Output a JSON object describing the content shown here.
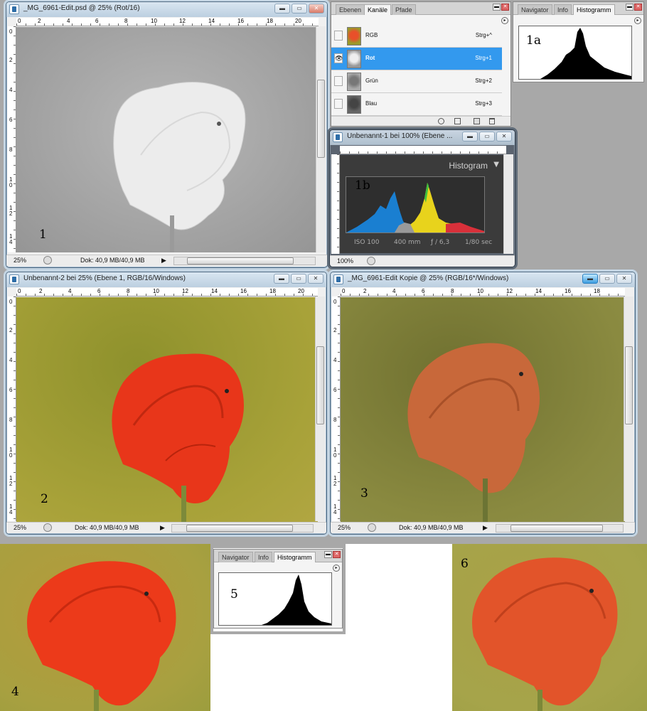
{
  "windows": {
    "w1": {
      "title": "_MG_6961-Edit.psd @ 25% (Rot/16)",
      "zoom": "25%",
      "doc": "Dok: 40,9 MB/40,9 MB",
      "label": "1"
    },
    "w2": {
      "title": "Unbenannt-2 bei 25% (Ebene 1, RGB/16/Windows)",
      "zoom": "25%",
      "doc": "Dok: 40,9 MB/40,9 MB",
      "label": "2"
    },
    "w3": {
      "title": "_MG_6961-Edit Kopie @ 25% (RGB/16*/Windows)",
      "zoom": "25%",
      "doc": "Dok: 40,9 MB/40,9 MB",
      "label": "3"
    },
    "wb": {
      "title": "Unbenannt-1 bei 100% (Ebene ...",
      "zoom": "100%",
      "label": "1b",
      "hist_title": "Histogram",
      "iso": "ISO 100",
      "focal": "400 mm",
      "aperture": "ƒ / 6,3",
      "shutter": "1/80 sec"
    }
  },
  "ruler_h_numbers": [
    "0",
    "2",
    "4",
    "6",
    "8",
    "10",
    "12",
    "14",
    "16",
    "18",
    "20"
  ],
  "ruler_v_numbers": [
    "0",
    "2",
    "4",
    "6",
    "8",
    "1\n0",
    "1\n2",
    "1\n4"
  ],
  "ruler_v_short": [
    "0",
    "2",
    "4",
    "6",
    "8",
    "1\n0",
    "1\n2",
    "1\n4"
  ],
  "channels_panel": {
    "tabs": [
      "Ebenen",
      "Kanäle",
      "Pfade"
    ],
    "rows": [
      {
        "name": "RGB",
        "key": "Strg+^"
      },
      {
        "name": "Rot",
        "key": "Strg+1"
      },
      {
        "name": "Grün",
        "key": "Strg+2"
      },
      {
        "name": "Blau",
        "key": "Strg+3"
      }
    ]
  },
  "histogram_panel_1a": {
    "tabs": [
      "Navigator",
      "Info",
      "Histogramm"
    ],
    "label": "1a"
  },
  "histogram_panel_5": {
    "tabs": [
      "Navigator",
      "Info",
      "Histogramm"
    ],
    "label": "5"
  },
  "standalone_labels": {
    "p4": "4",
    "p6": "6"
  },
  "icons": {
    "min": "minimize-icon",
    "max": "maximize-icon",
    "close": "close-icon"
  }
}
